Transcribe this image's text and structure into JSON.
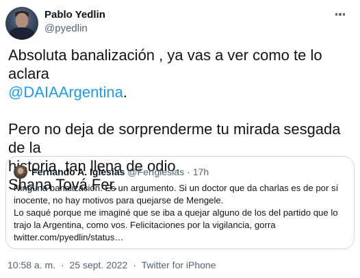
{
  "author": {
    "name": "Pablo Yedlin",
    "handle": "@pyedlin"
  },
  "tweet": {
    "line1": "Absoluta banalización , ya vas a ver como te lo aclara",
    "mention": "@DAIAArgentina",
    "mention_suffix": ".",
    "line3": "Pero no deja de sorprenderme tu mirada sesgada de la",
    "line4": "historia, tan llena de odio.",
    "line5": "Shana Tová Fer."
  },
  "quote": {
    "name": "Fernando A. Iglesias",
    "handle": "@FerIglesias",
    "separator": "·",
    "time": "17h",
    "lines": [
      "Ninguna banalización. Es un argumento. Si un doctor que da charlas es de por sí",
      "inocente, no hay motivos para quejarse de Mengele.",
      "Lo saqué porque me imaginé que se iba a quejar alguno de los del partido que lo",
      "trajo la Argentina, como vos. Felicitaciones por la vigilancia, gorra",
      "twitter.com/pyedlin/status…"
    ]
  },
  "footer": {
    "time": "10:58 a. m.",
    "separator": "·",
    "date": "25 sept. 2022",
    "source": "Twitter for iPhone"
  },
  "colors": {
    "accent": "#1d9bf0",
    "text": "#0f1419",
    "secondary": "#536471",
    "border": "#cfd9de"
  },
  "icons": {
    "more": "more-horizontal-icon"
  }
}
